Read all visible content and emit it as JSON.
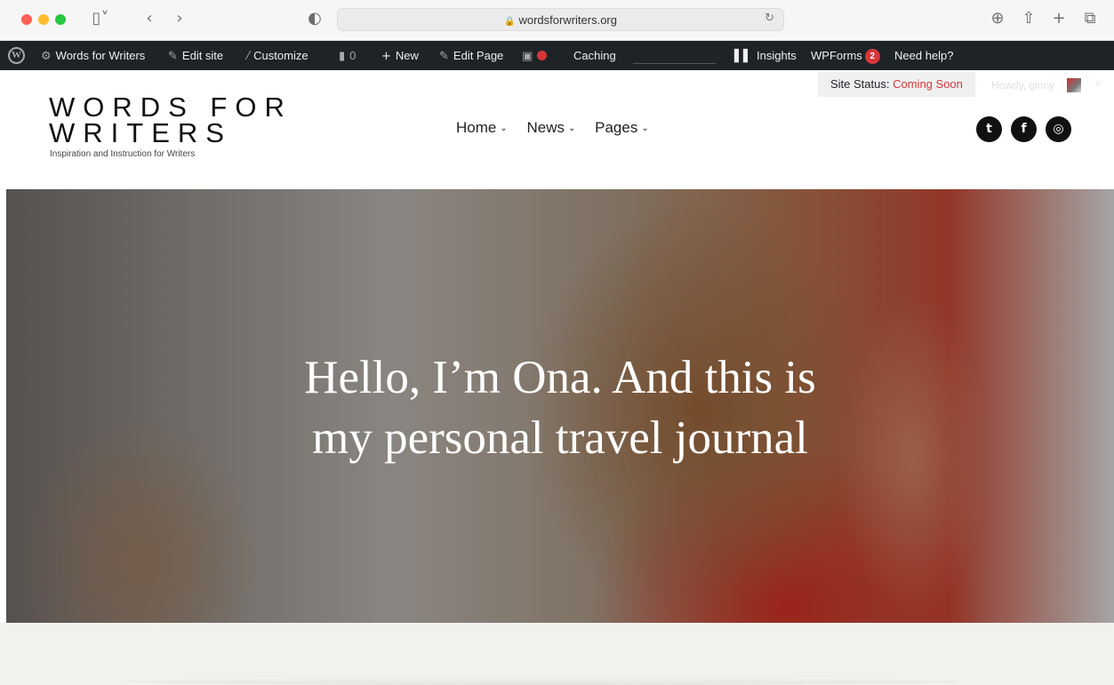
{
  "browser": {
    "url": "wordsforwriters.org",
    "icons": {
      "sidebar": "sidebar-icon",
      "back": "chevron-left-icon",
      "forward": "chevron-right-icon",
      "shield": "shield-icon",
      "reload": "reload-icon",
      "download": "download-icon",
      "share": "share-icon",
      "new_tab": "plus-icon",
      "tabs": "tabs-overview-icon"
    }
  },
  "adminbar": {
    "site_name": "Words for Writers",
    "edit_site": "Edit site",
    "customize": "Customize",
    "comments_count": "0",
    "new": "New",
    "edit_page": "Edit Page",
    "caching": "Caching",
    "insights": "Insights",
    "wpforms": "WPForms",
    "wpforms_count": "2",
    "need_help": "Need help?"
  },
  "header": {
    "status_label": "Site Status:",
    "status_value": "Coming Soon",
    "howdy": "Howdy, ginny",
    "logo_line1": "WORDS FOR",
    "logo_line2": "WRITERS",
    "tagline": "Inspiration and Instruction for Writers",
    "nav": [
      {
        "label": "Home"
      },
      {
        "label": "News"
      },
      {
        "label": "Pages"
      }
    ],
    "social": [
      "twitter-icon",
      "facebook-icon",
      "instagram-icon"
    ]
  },
  "hero": {
    "line1": "Hello, I’m Ona. And this is",
    "line2": "my personal travel journal"
  },
  "colors": {
    "adminbar_bg": "#1d2327",
    "status_red": "#d63638",
    "below_hero_bg": "#f3f1ee"
  }
}
